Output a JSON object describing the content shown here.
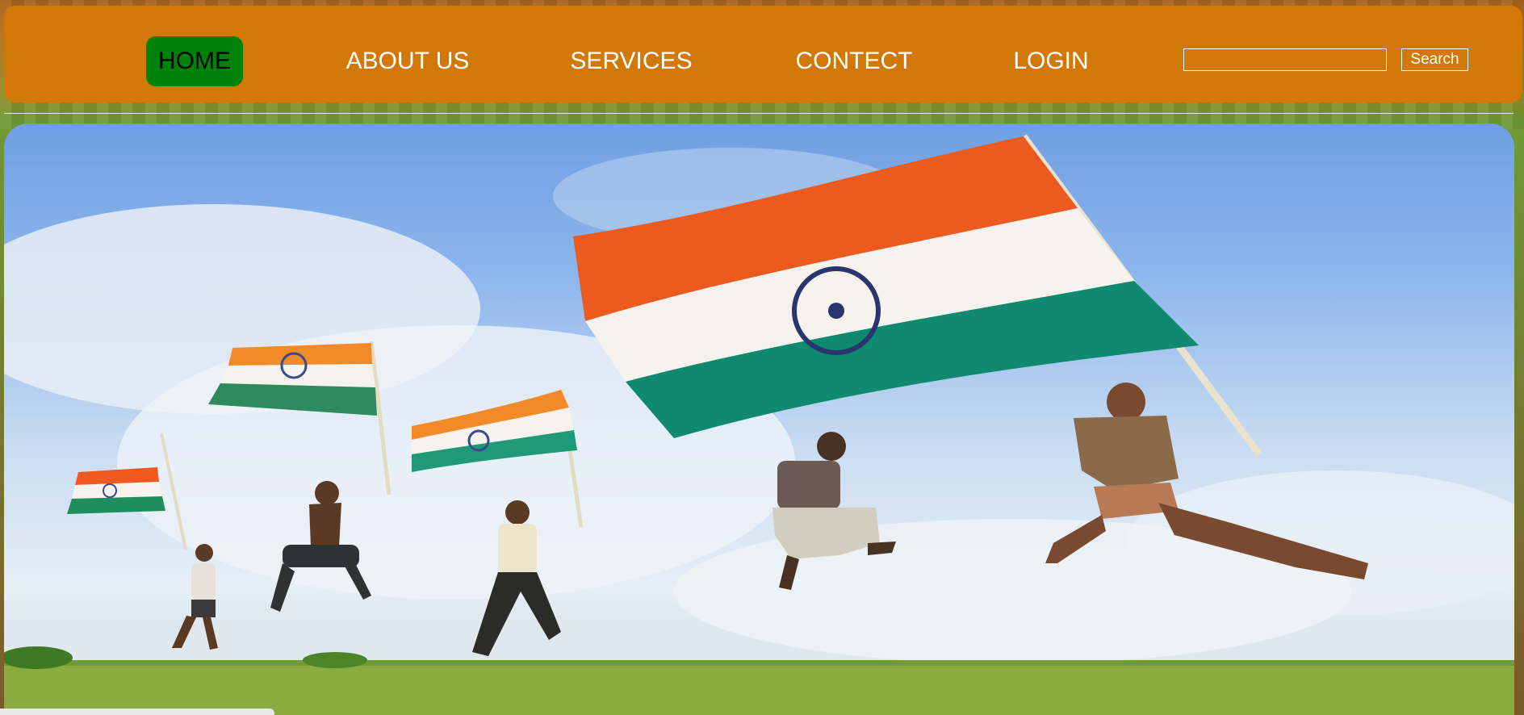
{
  "nav": {
    "items": [
      {
        "label": "HOME",
        "active": true
      },
      {
        "label": "ABOUT US",
        "active": false
      },
      {
        "label": "SERVICES",
        "active": false
      },
      {
        "label": "CONTECT",
        "active": false
      },
      {
        "label": "LOGIN",
        "active": false
      }
    ]
  },
  "search": {
    "value": "",
    "button_label": "Search"
  },
  "colors": {
    "navbar": "#d17807",
    "active_tab": "#00810a",
    "nav_text": "#ffffff"
  },
  "hero": {
    "image_subject": "children-running-with-indian-flags"
  }
}
